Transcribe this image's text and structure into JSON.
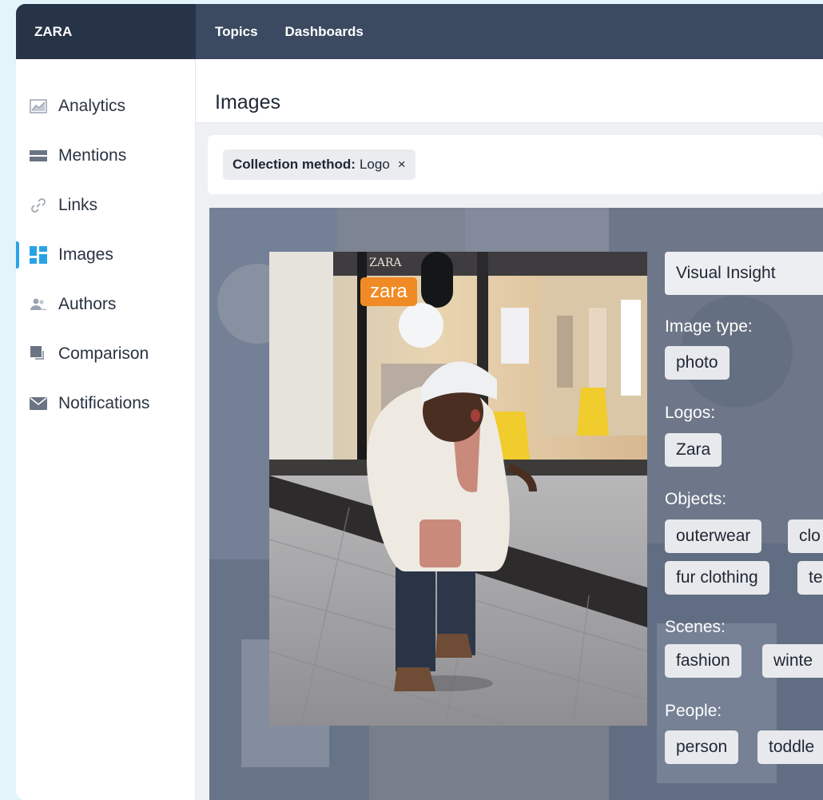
{
  "brand": "ZARA",
  "nav": [
    "Topics",
    "Dashboards"
  ],
  "sidebar": {
    "items": [
      {
        "label": "Analytics",
        "icon": "chart-line-icon"
      },
      {
        "label": "Mentions",
        "icon": "mentions-icon"
      },
      {
        "label": "Links",
        "icon": "link-icon"
      },
      {
        "label": "Images",
        "icon": "images-grid-icon",
        "active": true
      },
      {
        "label": "Authors",
        "icon": "people-icon"
      },
      {
        "label": "Comparison",
        "icon": "comparison-icon"
      },
      {
        "label": "Notifications",
        "icon": "envelope-icon"
      }
    ]
  },
  "page": {
    "title": "Images"
  },
  "filter": {
    "key": "Collection method:",
    "value": "Logo",
    "remove": "×"
  },
  "photo": {
    "logo_tag": "zara",
    "sign_text": "ZARA"
  },
  "insight": {
    "header": "Visual Insight",
    "sections": {
      "image_type": {
        "label": "Image type:",
        "tags": [
          "photo"
        ]
      },
      "logos": {
        "label": "Logos:",
        "tags": [
          "Zara"
        ]
      },
      "objects": {
        "label": "Objects:",
        "tags": [
          "outerwear",
          "clo",
          "fur clothing",
          "te"
        ]
      },
      "scenes": {
        "label": "Scenes:",
        "tags": [
          "fashion",
          "winte"
        ]
      },
      "people": {
        "label": "People:",
        "tags": [
          "person",
          "toddle"
        ]
      }
    }
  },
  "colors": {
    "accent": "#2aa3e6",
    "topbar": "#3b4961",
    "brand_bg": "#273347",
    "logo_tag": "#f08a24"
  }
}
